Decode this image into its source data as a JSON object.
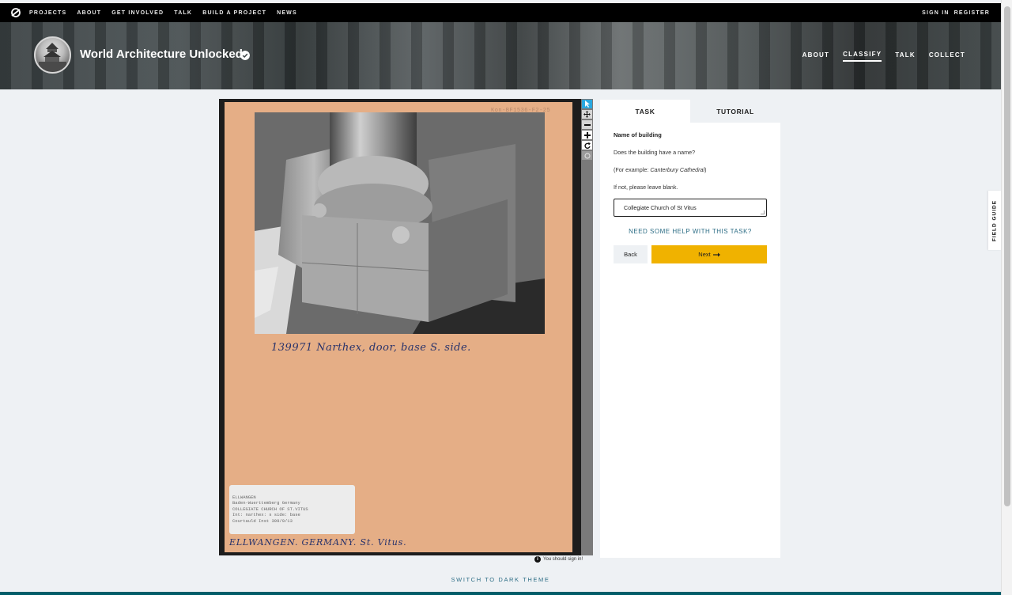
{
  "topnav": {
    "logo_icon": "zooniverse-logo-icon",
    "links": [
      "PROJECTS",
      "ABOUT",
      "GET INVOLVED",
      "TALK",
      "BUILD A PROJECT",
      "NEWS"
    ],
    "sign_in": "SIGN IN",
    "register": "REGISTER"
  },
  "project": {
    "title": "World Architecture Unlocked",
    "verified_icon": "check-circle-icon",
    "nav": [
      {
        "label": "ABOUT",
        "active": false
      },
      {
        "label": "CLASSIFY",
        "active": true
      },
      {
        "label": "TALK",
        "active": false
      },
      {
        "label": "COLLECT",
        "active": false
      }
    ]
  },
  "subject": {
    "accession": "Kon-BF1536-F2-25",
    "caption": "139971 Narthex, door, base S. side.",
    "bottom_ink": "ELLWANGEN. GERMANY. St. Vitus.",
    "label_lines": [
      "ELLWANGEN",
      "Baden-Wuerttemberg Germany",
      "COLLEGIATE CHURCH OF ST.VITUS",
      "Int: narthex: s side: base",
      "Courtauld Inst 309/9/13"
    ],
    "tools": [
      "pointer-icon",
      "move-icon",
      "zoom-out-icon",
      "zoom-in-icon",
      "rotate-icon",
      "reset-icon"
    ],
    "signin_note": "You should sign in!"
  },
  "task_panel": {
    "tabs": [
      "TASK",
      "TUTORIAL"
    ],
    "question_title": "Name of building",
    "question_text": "Does the building have a name?",
    "example_prefix": "(For example: ",
    "example_name": "Canterbury Cathedral",
    "example_suffix": ")",
    "blank_note": "If not, please leave blank.",
    "answer_value": "Collegiate Church of St Vitus",
    "help_link": "NEED SOME HELP WITH THIS TASK?",
    "back_label": "Back",
    "next_label": "Next",
    "next_icon": "arrow-right-icon"
  },
  "field_guide": "FIELD GUIDE",
  "theme_toggle": "SWITCH TO DARK THEME",
  "colors": {
    "next_button": "#f0b200",
    "link_teal": "#2e6e86",
    "card_tan": "#e5ae86",
    "footer_teal": "#005d69"
  }
}
